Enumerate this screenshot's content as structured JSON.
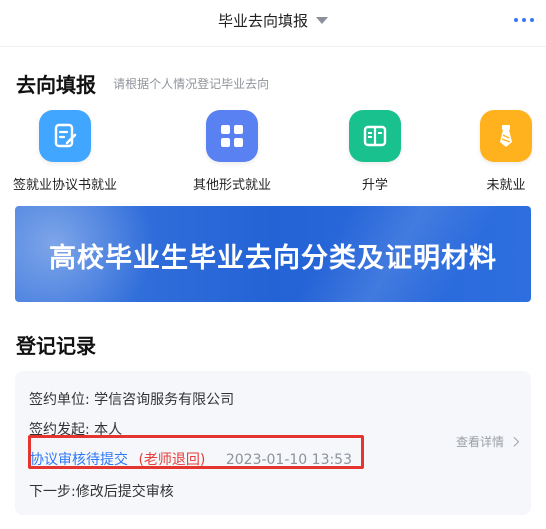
{
  "header": {
    "title": "毕业去向填报",
    "caret_icon": "chevron-down-icon",
    "more_icon": "more-icon"
  },
  "destination_section": {
    "title": "去向填报",
    "subtitle": "请根据个人情况登记毕业去向",
    "entries": [
      {
        "label": "签就业协议书就业",
        "icon": "document-edit-icon",
        "color": "#41a6ff"
      },
      {
        "label": "其他形式就业",
        "icon": "grid-icon",
        "color": "#5a81f2"
      },
      {
        "label": "升学",
        "icon": "book-icon",
        "color": "#19c18f"
      },
      {
        "label": "未就业",
        "icon": "tie-icon",
        "color": "#ffb21d"
      }
    ]
  },
  "banner": {
    "text": "高校毕业生毕业去向分类及证明材料"
  },
  "records_section": {
    "title": "登记记录",
    "record": {
      "unit_label": "签约单位:",
      "unit_value": "学信咨询服务有限公司",
      "initiator_label": "签约发起:",
      "initiator_value": "本人",
      "status": "协议审核待提交",
      "return_note": "(老师退回)",
      "time": "2023-01-10 13:53",
      "detail_label": "查看详情",
      "next_step": "下一步:修改后提交审核"
    }
  },
  "colors": {
    "status_blue": "#2f79f6",
    "return_red": "#e43f3a",
    "highlight_box": "#e5352f"
  }
}
